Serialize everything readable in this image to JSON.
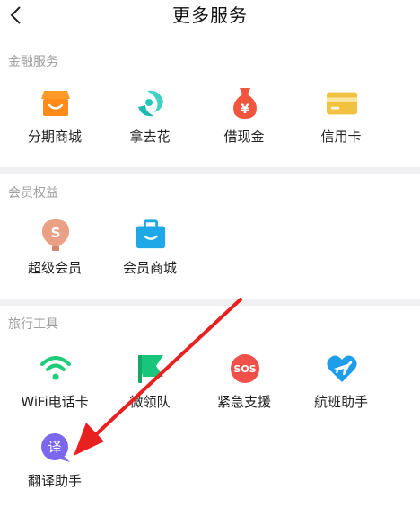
{
  "header": {
    "title": "更多服务"
  },
  "sections": [
    {
      "title": "金融服务",
      "items": [
        {
          "label": "分期商城",
          "icon": "store-icon"
        },
        {
          "label": "拿去花",
          "icon": "spend-icon"
        },
        {
          "label": "借现金",
          "icon": "money-bag-icon"
        },
        {
          "label": "信用卡",
          "icon": "credit-card-icon"
        }
      ]
    },
    {
      "title": "会员权益",
      "items": [
        {
          "label": "超级会员",
          "icon": "super-member-icon"
        },
        {
          "label": "会员商城",
          "icon": "member-mall-icon"
        }
      ]
    },
    {
      "title": "旅行工具",
      "items": [
        {
          "label": "WiFi电话卡",
          "icon": "wifi-icon"
        },
        {
          "label": "微领队",
          "icon": "flag-icon"
        },
        {
          "label": "紧急支援",
          "icon": "sos-icon"
        },
        {
          "label": "航班助手",
          "icon": "flight-icon"
        },
        {
          "label": "翻译助手",
          "icon": "translate-icon"
        }
      ]
    }
  ],
  "icon_glyphs": {
    "sos": "SOS",
    "translate": "译"
  },
  "colors": {
    "store": "#ff8a1a",
    "spend": "#26c6b8",
    "money_bag": "#f2553f",
    "credit_card": "#f0c240",
    "super_member": "#e9a084",
    "member_mall": "#1ea8e8",
    "wifi": "#1fcc7a",
    "flag": "#19c57a",
    "sos": "#f0504a",
    "flight": "#1e9ee8",
    "translate": "#7a66ef",
    "annotation_arrow": "#e82020"
  }
}
